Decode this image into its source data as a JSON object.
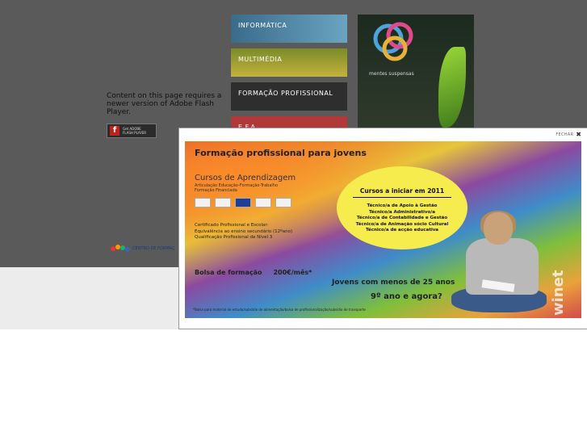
{
  "background": {
    "flash_notice": "Content on this page requires a newer version of Adobe Flash Player.",
    "flash_button": {
      "line1": "Get ADOBE",
      "line2": "FLASH PLAYER"
    },
    "logo_text": "CENTRO DE FORMAÇ",
    "menu": [
      {
        "label": "INFORMÁTICA"
      },
      {
        "label": "MULTIMÉDIA"
      },
      {
        "label": "FORMAÇÃO PROFISSIONAL"
      },
      {
        "label": "E.F.A"
      }
    ],
    "right_panel": {
      "brand": "mentes suspensas"
    }
  },
  "modal": {
    "close_label": "FECHAR",
    "close_glyph": "✖",
    "banner": {
      "title": "Formação profissional para jovens",
      "subtitle": "Cursos de Aprendizagem",
      "subtitle_small": "Articulação Educação-Formação-Trabalho\nFormação Financiada",
      "certification": [
        "Certificado Profissional e Escolar:",
        "Equivalência ao ensino secundário (12ºano)",
        "Qualificação Profissional de Nível 3"
      ],
      "bolsa": "Bolsa de formação     200€/mês*",
      "oval": {
        "title": "Cursos a iniciar em 2011",
        "courses": [
          "Técnico/a de Apoio à Gestão",
          "Técnico/a Administrativo/a",
          "Técnico/a de Contabilidade e Gestão",
          "Técnico/a de Animação sócio Cultural",
          "Técnico/a de acção educativa"
        ]
      },
      "jovens": "Jovens com menos de 25 anos",
      "question": "9º ano e agora?",
      "footnote": "*Bolsa para material de estudo/subsídio de alimentação/bolsa de profissionalização/subsídio de transporte",
      "vertical_text": "winet"
    }
  },
  "colors": {
    "overlay": "#5a5a5a",
    "oval": "#f7ec4e"
  }
}
